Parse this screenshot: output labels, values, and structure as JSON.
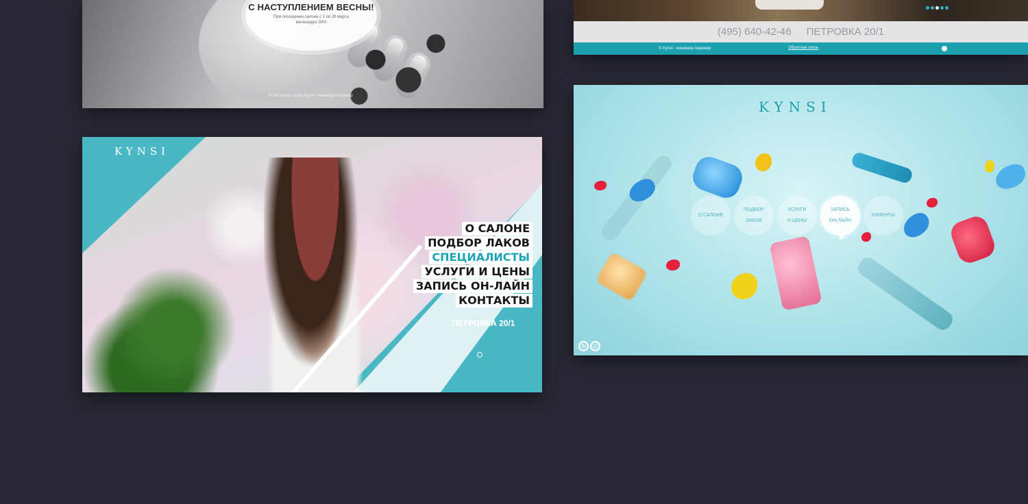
{
  "colors": {
    "background": "#272833",
    "accent": "#1aa1ad",
    "menu_active": "#19a5b3"
  },
  "shot1": {
    "headline": "С НАСТУПЛЕНИЕМ ВЕСНЫ!",
    "promo_line1": "При посещении салона с 1 по 26 марта",
    "promo_line2": "мегаскидка 30%",
    "copyright": "© Экспресс-салон Kynsi - маникюр-педикюр"
  },
  "shot2": {
    "phone": "(495) 640-42-46",
    "address": "ПЕТРОВКА 20/1",
    "copyright": "© Kynsi - маникюр-педикюр",
    "feedback_link": "Обратная связь",
    "slider_dots": 5,
    "slider_active": 3
  },
  "shot3": {
    "logo": "KYNSI",
    "menu": [
      {
        "label": "О САЛОНЕ",
        "active": false
      },
      {
        "label": "ПОДБОР ЛАКОВ",
        "active": false
      },
      {
        "label": "СПЕЦИАЛИСТЫ",
        "active": true
      },
      {
        "label": "УСЛУГИ И ЦЕНЫ",
        "active": false
      },
      {
        "label": "ЗАПИСЬ ОН-ЛАЙН",
        "active": false
      },
      {
        "label": "КОНТАКТЫ",
        "active": false
      }
    ],
    "address": "ПЕТРОВКА 20/1"
  },
  "shot4": {
    "logo": "KYNSI",
    "nav": [
      {
        "line1": "О САЛОНЕ",
        "line2": "",
        "active": false
      },
      {
        "line1": "ПОДБОР",
        "line2": "ЛАКОВ",
        "active": false
      },
      {
        "line1": "УСЛУГИ",
        "line2": "И ЦЕНЫ",
        "active": false
      },
      {
        "line1": "ЗАПИСЬ",
        "line2": "ОН-ЛАЙН",
        "active": true
      },
      {
        "line1": "КЛИЕНТЫ",
        "line2": "",
        "active": false
      }
    ],
    "icons": [
      "link-icon",
      "home-icon"
    ]
  }
}
